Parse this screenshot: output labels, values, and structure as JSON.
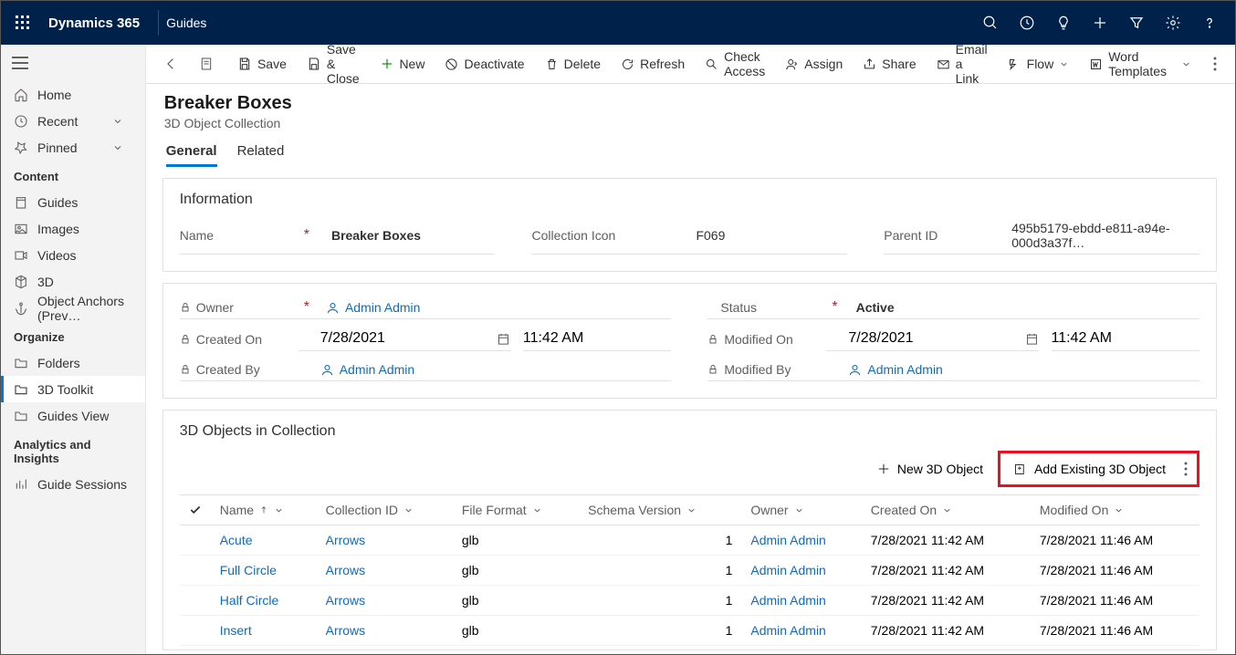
{
  "header": {
    "brand": "Dynamics 365",
    "module": "Guides"
  },
  "nav": {
    "home": "Home",
    "recent": "Recent",
    "pinned": "Pinned",
    "content_section": "Content",
    "guides": "Guides",
    "images": "Images",
    "videos": "Videos",
    "three_d": "3D",
    "object_anchors": "Object Anchors (Prev…",
    "organize_section": "Organize",
    "folders": "Folders",
    "toolkit": "3D Toolkit",
    "guides_view": "Guides View",
    "analytics_section": "Analytics and Insights",
    "guide_sessions": "Guide Sessions"
  },
  "commands": {
    "save": "Save",
    "save_close": "Save & Close",
    "new": "New",
    "deactivate": "Deactivate",
    "delete": "Delete",
    "refresh": "Refresh",
    "check_access": "Check Access",
    "assign": "Assign",
    "share": "Share",
    "email_link": "Email a Link",
    "flow": "Flow",
    "word_templates": "Word Templates"
  },
  "record": {
    "title": "Breaker Boxes",
    "subtitle": "3D Object Collection",
    "tabs": {
      "general": "General",
      "related": "Related"
    }
  },
  "info": {
    "section_title": "Information",
    "name_label": "Name",
    "name_value": "Breaker Boxes",
    "icon_label": "Collection Icon",
    "icon_value": "F069",
    "parent_label": "Parent ID",
    "parent_value": "495b5179-ebdd-e811-a94e-000d3a37f…"
  },
  "audit": {
    "owner_label": "Owner",
    "owner_value": "Admin Admin",
    "status_label": "Status",
    "status_value": "Active",
    "created_on_label": "Created On",
    "created_on_date": "7/28/2021",
    "created_on_time": "11:42 AM",
    "modified_on_label": "Modified On",
    "modified_on_date": "7/28/2021",
    "modified_on_time": "11:42 AM",
    "created_by_label": "Created By",
    "created_by_value": "Admin Admin",
    "modified_by_label": "Modified By",
    "modified_by_value": "Admin Admin"
  },
  "subgrid": {
    "title": "3D Objects in Collection",
    "new_btn": "New 3D Object",
    "add_btn": "Add Existing 3D Object",
    "cols": {
      "name": "Name",
      "collection_id": "Collection ID",
      "file_format": "File Format",
      "schema_version": "Schema Version",
      "owner": "Owner",
      "created_on": "Created On",
      "modified_on": "Modified On"
    },
    "rows": [
      {
        "name": "Acute",
        "collection": "Arrows",
        "format": "glb",
        "schema": "1",
        "owner": "Admin Admin",
        "created": "7/28/2021 11:42 AM",
        "modified": "7/28/2021 11:46 AM"
      },
      {
        "name": "Full Circle",
        "collection": "Arrows",
        "format": "glb",
        "schema": "1",
        "owner": "Admin Admin",
        "created": "7/28/2021 11:42 AM",
        "modified": "7/28/2021 11:46 AM"
      },
      {
        "name": "Half Circle",
        "collection": "Arrows",
        "format": "glb",
        "schema": "1",
        "owner": "Admin Admin",
        "created": "7/28/2021 11:42 AM",
        "modified": "7/28/2021 11:46 AM"
      },
      {
        "name": "Insert",
        "collection": "Arrows",
        "format": "glb",
        "schema": "1",
        "owner": "Admin Admin",
        "created": "7/28/2021 11:42 AM",
        "modified": "7/28/2021 11:46 AM"
      }
    ]
  }
}
